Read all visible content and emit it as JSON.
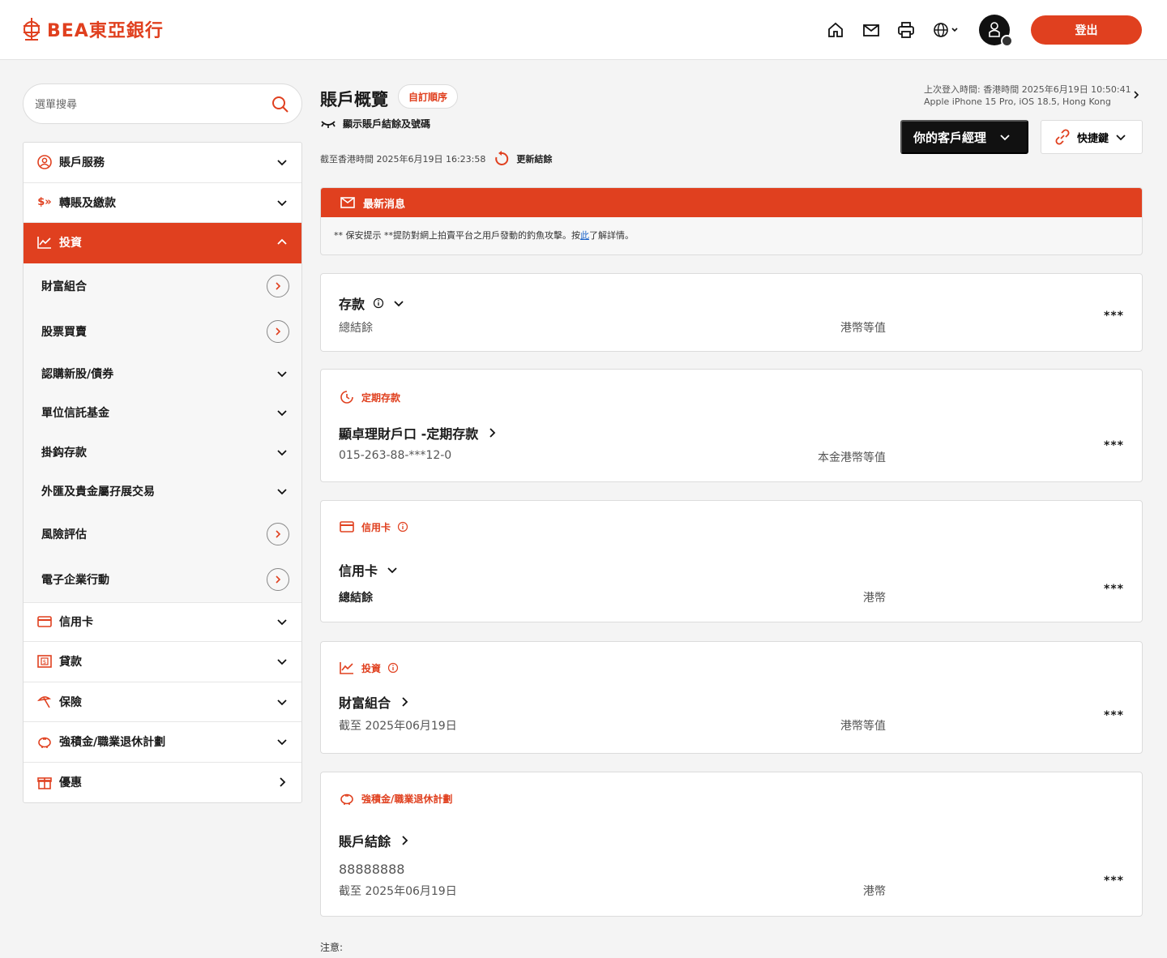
{
  "header": {
    "logo_text": "BEA東亞銀行",
    "logout_label": "登出",
    "brand_color": "#e0401f",
    "icons": [
      "home-icon",
      "mail-icon",
      "print-icon",
      "globe-icon",
      "user-avatar-icon"
    ]
  },
  "sidebar": {
    "search_placeholder": "選單搜尋",
    "items": [
      {
        "label": "賬戶服務",
        "icon": "user-circle-icon"
      },
      {
        "label": "轉賬及繳款",
        "icon": "transfer-icon"
      },
      {
        "label": "投資",
        "icon": "chart-icon"
      }
    ],
    "sub_items": [
      {
        "label": "財富組合"
      },
      {
        "label": "股票買賣"
      },
      {
        "label": "認購新股/債券"
      },
      {
        "label": "單位信託基金"
      },
      {
        "label": "掛鈎存款"
      },
      {
        "label": "外匯及貴金屬孖展交易"
      },
      {
        "label": "風險評估"
      },
      {
        "label": "電子企業行動"
      }
    ],
    "items_after": [
      {
        "label": "信用卡",
        "icon": "credit-card-icon"
      },
      {
        "label": "貸款",
        "icon": "loan-icon"
      },
      {
        "label": "保險",
        "icon": "umbrella-icon"
      },
      {
        "label": "強積金/職業退休計劃",
        "icon": "piggy-bank-icon"
      },
      {
        "label": "優惠",
        "icon": "gift-icon"
      }
    ]
  },
  "main": {
    "title": "賬戶概覽",
    "reorder_label": "自訂順序",
    "toggle_label": "顯示賬戶結餘及號碼",
    "as_of": "截至香港時間 2025年6月19日 16:23:58",
    "refresh_label": "更新結餘",
    "last_login_line1": "上次登入時間: 香港時間 2025年6月19日 10:50:41",
    "last_login_line2": "Apple iPhone 15 Pro, iOS 18.5, Hong Kong",
    "manager_label": "你的客戶經理",
    "quick_label": "快捷鍵",
    "news_title": "最新消息",
    "news_msg_prefix": "** 保安提示 **提防對網上拍賣平台之用戶發動的釣魚攻擊。按",
    "news_link": "此",
    "news_msg_suffix": "了解詳情。",
    "note": "注意:"
  },
  "cards": {
    "deposit": {
      "title": "存款",
      "sub": "總結餘",
      "ccy": "港幣等值",
      "mask": "***"
    },
    "fixed": {
      "cat": "定期存款",
      "title": "顯卓理財戶口 -定期存款",
      "sub": "015-263-88-***12-0",
      "ccy": "本金港幣等值",
      "mask": "***"
    },
    "credit": {
      "cat": "信用卡",
      "title": "信用卡",
      "sub": "總結餘",
      "ccy": "港幣",
      "mask": "***"
    },
    "invest": {
      "cat": "投資",
      "title": "財富組合",
      "sub": "截至 2025年06月19日",
      "ccy": "港幣等值",
      "mask": "***"
    },
    "mpf": {
      "cat": "強積金/職業退休計劃",
      "title": "賬戶結餘",
      "acct": "88888888",
      "sub": "截至 2025年06月19日",
      "ccy": "港幣",
      "mask": "***"
    }
  }
}
